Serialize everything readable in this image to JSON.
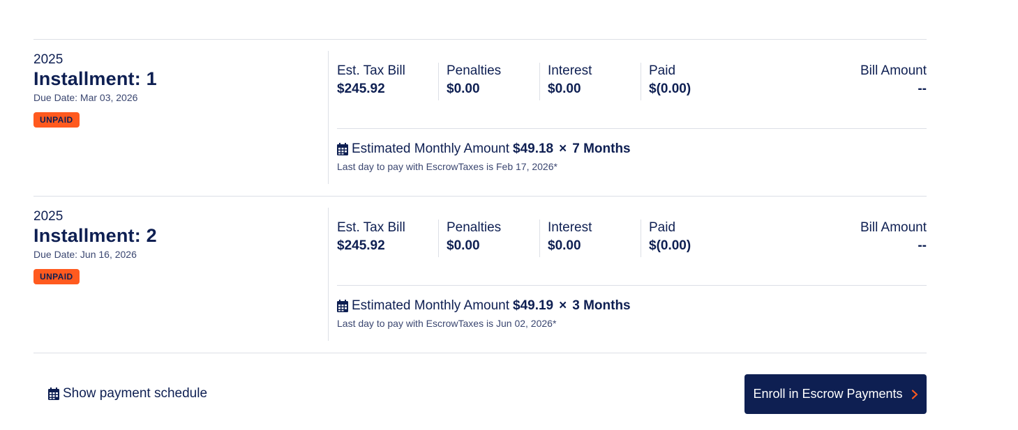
{
  "installments": [
    {
      "year": "2025",
      "title": "Installment: 1",
      "due_date": "Due Date: Mar 03, 2026",
      "status": "UNPAID",
      "columns": [
        {
          "label": "Est. Tax Bill",
          "value": "$245.92"
        },
        {
          "label": "Penalties",
          "value": "$0.00"
        },
        {
          "label": "Interest",
          "value": "$0.00"
        },
        {
          "label": "Paid",
          "value": "$(0.00)"
        }
      ],
      "bill_amount": {
        "label": "Bill Amount",
        "value": "--"
      },
      "estimate": {
        "label": "Estimated Monthly Amount",
        "amount": "$49.18",
        "times": "×",
        "months": "7 Months"
      },
      "last_day": "Last day to pay with EscrowTaxes is Feb 17, 2026*"
    },
    {
      "year": "2025",
      "title": "Installment: 2",
      "due_date": "Due Date: Jun 16, 2026",
      "status": "UNPAID",
      "columns": [
        {
          "label": "Est. Tax Bill",
          "value": "$245.92"
        },
        {
          "label": "Penalties",
          "value": "$0.00"
        },
        {
          "label": "Interest",
          "value": "$0.00"
        },
        {
          "label": "Paid",
          "value": "$(0.00)"
        }
      ],
      "bill_amount": {
        "label": "Bill Amount",
        "value": "--"
      },
      "estimate": {
        "label": "Estimated Monthly Amount",
        "amount": "$49.19",
        "times": "×",
        "months": "3 Months"
      },
      "last_day": "Last day to pay with EscrowTaxes is Jun 02, 2026*"
    }
  ],
  "footer": {
    "schedule_link": "Show payment schedule",
    "enroll_button": "Enroll in Escrow Payments"
  },
  "icons": {
    "calendar": "calendar-icon",
    "chevron": "chevron-right-icon"
  },
  "colors": {
    "navy": "#0e1f52",
    "badge": "#ff5a1f",
    "accent": "#ff5a1f"
  }
}
